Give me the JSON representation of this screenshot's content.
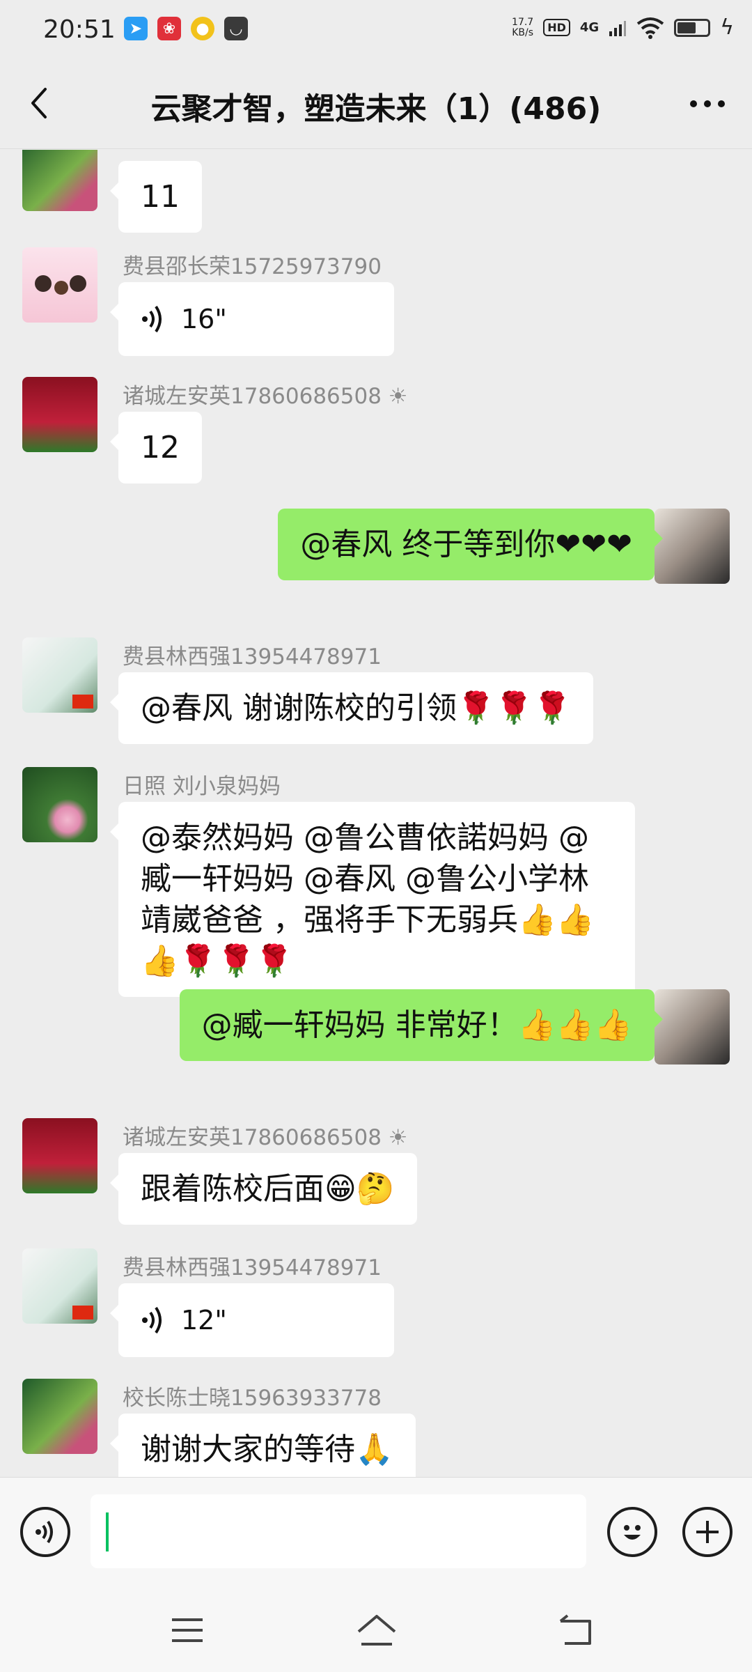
{
  "status_bar": {
    "time": "20:51",
    "net_speed_value": "17.7",
    "net_speed_unit": "KB/s",
    "hd": "HD",
    "network": "4G",
    "battery_level": 0.55,
    "icons": [
      "telegram-icon",
      "app-red-icon",
      "app-yellow-icon",
      "app-dark-icon",
      "wifi-icon",
      "battery-icon",
      "charging-icon"
    ]
  },
  "header": {
    "title": "云聚才智，塑造未来（1）(486)"
  },
  "messages": [
    {
      "side": "left",
      "sender": "",
      "text": "11",
      "avatar": "lotus-avatar"
    },
    {
      "side": "left",
      "sender": "费县邵长荣15725973790",
      "text": "16\"",
      "type": "voice",
      "avatar": "cartoon-family-avatar"
    },
    {
      "side": "left",
      "sender": "诸城左安英17860686508 ☀",
      "text": "12",
      "avatar": "stage-speaker-avatar"
    },
    {
      "side": "right",
      "sender": "",
      "text": "@春风  终于等到你❤❤❤",
      "avatar": "woman-portrait-avatar"
    },
    {
      "side": "left",
      "sender": "费县林西强13954478971",
      "text": "@春风  谢谢陈校的引领🌹🌹🌹",
      "avatar": "grasshopper-avatar"
    },
    {
      "side": "left",
      "sender": "日照  刘小泉妈妈",
      "text": "@泰然妈妈  @鲁公曹依諾妈妈  @臧一轩妈妈  @春风  @鲁公小学林靖崴爸爸 ，强将手下无弱兵👍👍👍🌹🌹🌹",
      "avatar": "lotus-pond-avatar"
    },
    {
      "side": "right",
      "sender": "",
      "text": "@臧一轩妈妈  非常好！👍👍👍",
      "avatar": "woman-portrait-avatar"
    },
    {
      "side": "left",
      "sender": "诸城左安英17860686508 ☀",
      "text": "跟着陈校后面😁🤔",
      "avatar": "stage-speaker-avatar"
    },
    {
      "side": "left",
      "sender": "费县林西强13954478971",
      "text": "12\"",
      "type": "voice",
      "avatar": "grasshopper-avatar"
    },
    {
      "side": "left",
      "sender": "校长陈士晓15963933778",
      "text": "谢谢大家的等待🙏",
      "avatar": "lotus-avatar"
    }
  ],
  "input_bar": {
    "value": "",
    "icons": [
      "voice-input-icon",
      "emoji-icon",
      "plus-icon"
    ]
  },
  "nav_bar": {
    "icons": [
      "menu-icon",
      "home-icon",
      "back-nav-icon"
    ]
  },
  "colors": {
    "background": "#ededed",
    "self_bubble": "#95ec69",
    "other_bubble": "#ffffff",
    "caret": "#07c160"
  }
}
